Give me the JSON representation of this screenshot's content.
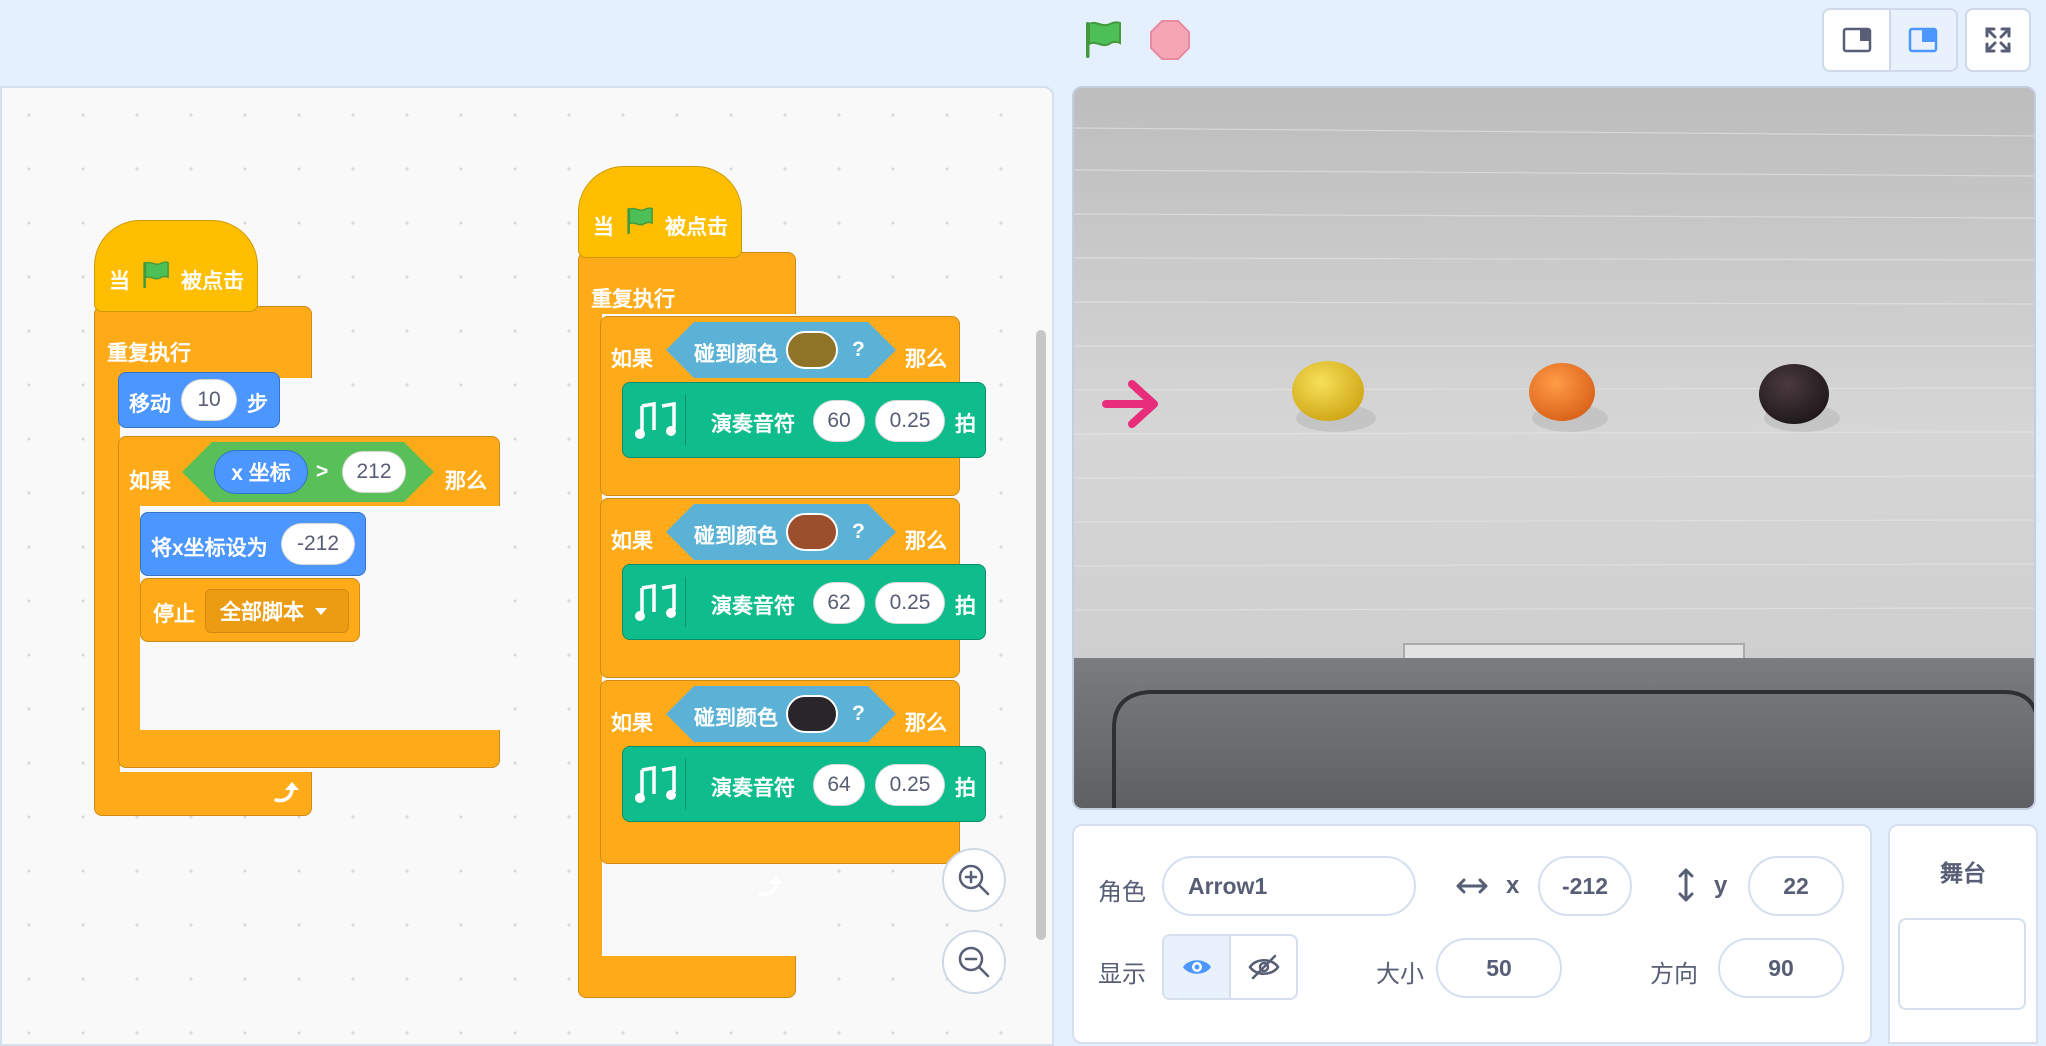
{
  "topbar": {
    "green_flag_icon": "green-flag-icon",
    "stop_icon": "stop-icon",
    "modes": [
      "small-stage-mode",
      "normal-stage-mode"
    ],
    "fullscreen_icon": "fullscreen-icon"
  },
  "script1": {
    "hat_when": "当",
    "hat_clicked": "被点击",
    "forever": "重复执行",
    "move_label": "移动",
    "move_steps": "10",
    "move_unit": "步",
    "if_label": "如果",
    "x_reporter": "x 坐标",
    "gt_symbol": ">",
    "compare_value": "212",
    "then_label": "那么",
    "set_x_label": "将x坐标设为",
    "set_x_value": "-212",
    "stop_label": "停止",
    "stop_option": "全部脚本"
  },
  "script2": {
    "hat_when": "当",
    "hat_clicked": "被点击",
    "forever": "重复执行",
    "branches": [
      {
        "if_label": "如果",
        "touch_label": "碰到颜色",
        "question": "?",
        "then_label": "那么",
        "color": "#8f7427",
        "play_label": "演奏音符",
        "note": "60",
        "beats": "0.25",
        "beat_unit": "拍"
      },
      {
        "if_label": "如果",
        "touch_label": "碰到颜色",
        "question": "?",
        "then_label": "那么",
        "color": "#9b4f2c",
        "play_label": "演奏音符",
        "note": "62",
        "beats": "0.25",
        "beat_unit": "拍"
      },
      {
        "if_label": "如果",
        "touch_label": "碰到颜色",
        "question": "?",
        "then_label": "那么",
        "color": "#2a2528",
        "play_label": "演奏音符",
        "note": "64",
        "beats": "0.25",
        "beat_unit": "拍"
      }
    ]
  },
  "zoom": {
    "in_icon": "zoom-in-icon",
    "out_icon": "zoom-out-icon"
  },
  "stage": {
    "sprite_icon": "arrow-icon",
    "candy_colors": [
      "#e8c41e",
      "#f07a24",
      "#2b2024"
    ]
  },
  "sprite_info": {
    "sprite_label": "角色",
    "sprite_name": "Arrow1",
    "x_label": "x",
    "x_value": "-212",
    "y_label": "y",
    "y_value": "22",
    "show_label": "显示",
    "size_label": "大小",
    "size_value": "50",
    "direction_label": "方向",
    "direction_value": "90"
  },
  "stage_panel": {
    "title": "舞台"
  },
  "colors": {
    "events": "#ffbf00",
    "control": "#ffab19",
    "motion": "#4c97ff",
    "sensing": "#5cb1d6",
    "operators": "#59c059",
    "music": "#0fbd8c",
    "accent": "#4c97ff"
  }
}
